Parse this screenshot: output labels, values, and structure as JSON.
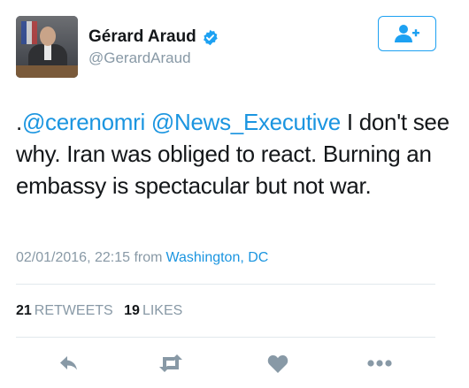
{
  "author": {
    "name": "Gérard Araud",
    "handle": "@GerardAraud",
    "verified": true
  },
  "follow_button": {
    "icon": "add-user-icon"
  },
  "tweet": {
    "prefix": ".",
    "mention1": "@cerenomri",
    "mention2": "@News_Executive",
    "body": " I don't see why. Iran was obliged to react. Burning an embassy is spectacular but not war."
  },
  "meta": {
    "timestamp": "02/01/2016, 22:15 from",
    "location": "Washington, DC"
  },
  "stats": {
    "retweets_count": "21",
    "retweets_label": "RETWEETS",
    "likes_count": "19",
    "likes_label": "LIKES"
  },
  "actions": [
    "reply-icon",
    "retweet-icon",
    "like-icon",
    "more-icon"
  ],
  "colors": {
    "accent": "#1da1f2",
    "link": "#1b95e0",
    "muted": "#8899a6",
    "text": "#14171a"
  }
}
